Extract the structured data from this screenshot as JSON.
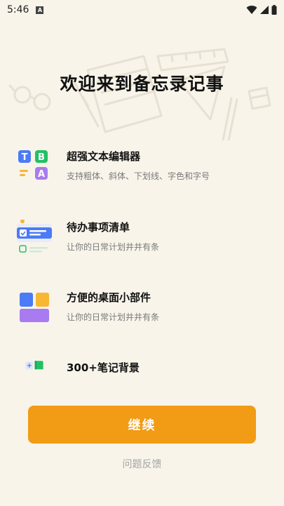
{
  "status_bar": {
    "time": "5:46",
    "notification_badge": "A",
    "icons": [
      "wifi-icon",
      "signal-icon",
      "battery-icon"
    ]
  },
  "title": "欢迎来到备忘录记事",
  "features": [
    {
      "icon": "text-editor-icon",
      "title": "超强文本编辑器",
      "desc": "支持粗体、斜体、下划线、字色和字号"
    },
    {
      "icon": "todo-list-icon",
      "title": "待办事项清单",
      "desc": "让你的日常计划井井有条"
    },
    {
      "icon": "widget-icon",
      "title": "方便的桌面小部件",
      "desc": "让你的日常计划井井有条"
    },
    {
      "icon": "background-icon",
      "title": "300+笔记背景",
      "desc": ""
    }
  ],
  "text_editor_icon_letters": [
    "T",
    "B",
    "A"
  ],
  "continue_label": "继续",
  "feedback_label": "问题反馈",
  "colors": {
    "background": "#f8f4ea",
    "accent": "#f29b15",
    "blue": "#4b7bf5",
    "green": "#22c064",
    "purple": "#a87bf0",
    "yellow": "#f7b733"
  }
}
